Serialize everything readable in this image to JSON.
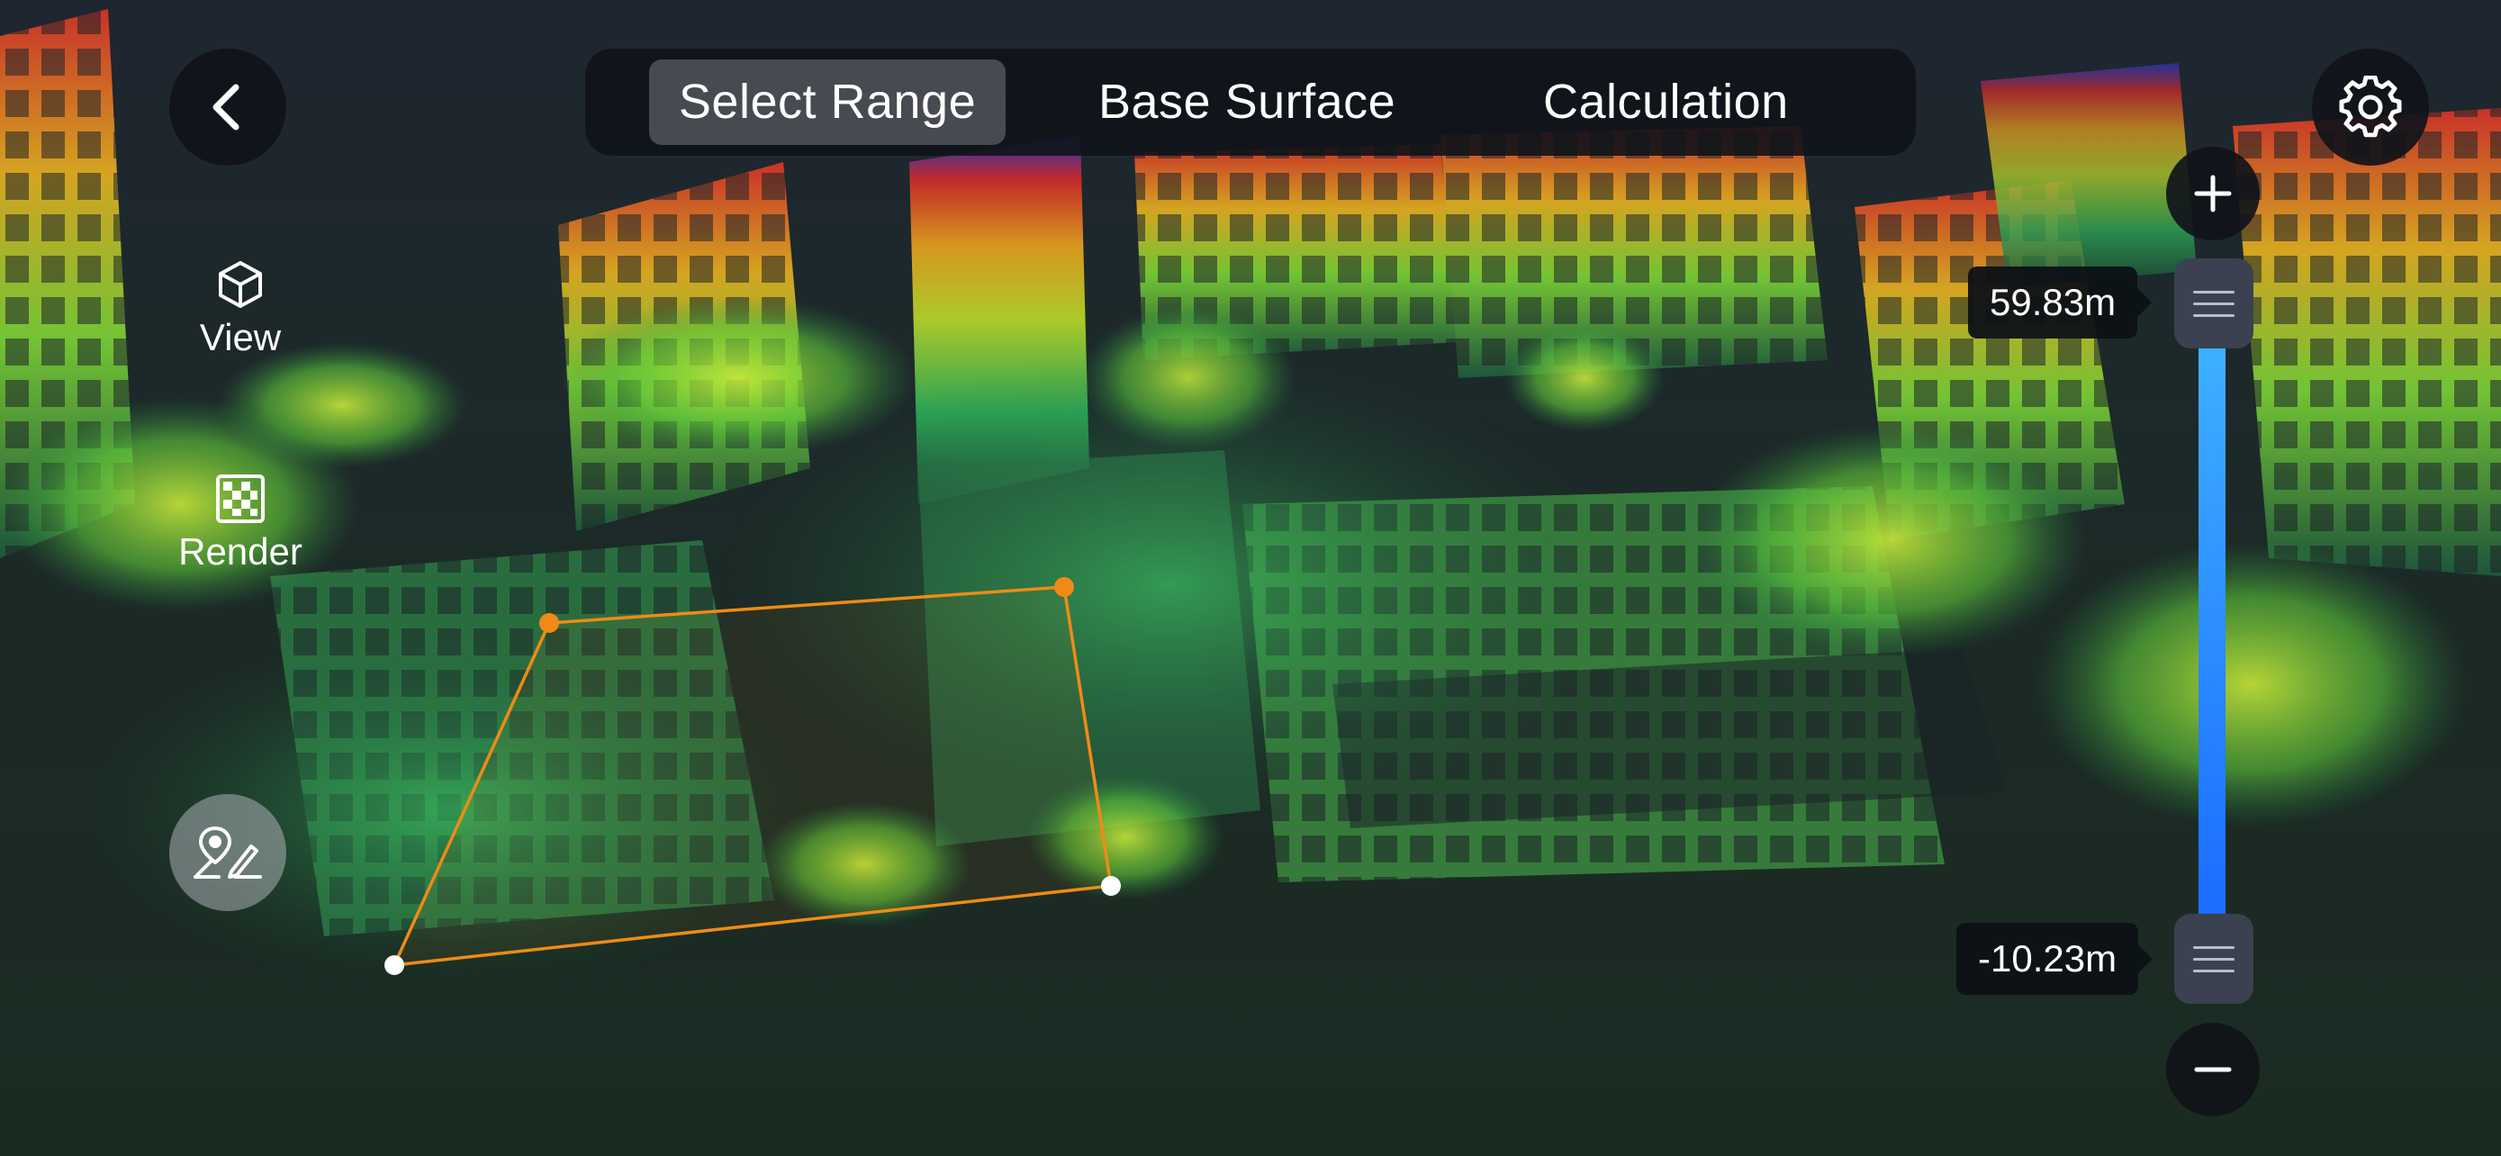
{
  "tabs": [
    {
      "label": "Select Range",
      "active": true
    },
    {
      "label": "Base Surface",
      "active": false
    },
    {
      "label": "Calculation",
      "active": false
    }
  ],
  "sidebar": {
    "view": {
      "label": "View",
      "icon": "cube-icon"
    },
    "render": {
      "label": "Render",
      "icon": "checker-render-icon"
    }
  },
  "toolbar": {
    "back_icon": "chevron-left-icon",
    "settings_icon": "gear-icon",
    "draw_tool_icon": "map-pin-pencil-icon"
  },
  "height_range": {
    "top_label": "59.83m",
    "bottom_label": "-10.23m",
    "zoom_in_icon": "plus-icon",
    "zoom_out_icon": "minus-icon"
  },
  "colors": {
    "accent_orange": "#f08a16",
    "slider_top": "#3fb0ff",
    "slider_bottom": "#1a6cff",
    "panel_bg": "#10141a"
  }
}
